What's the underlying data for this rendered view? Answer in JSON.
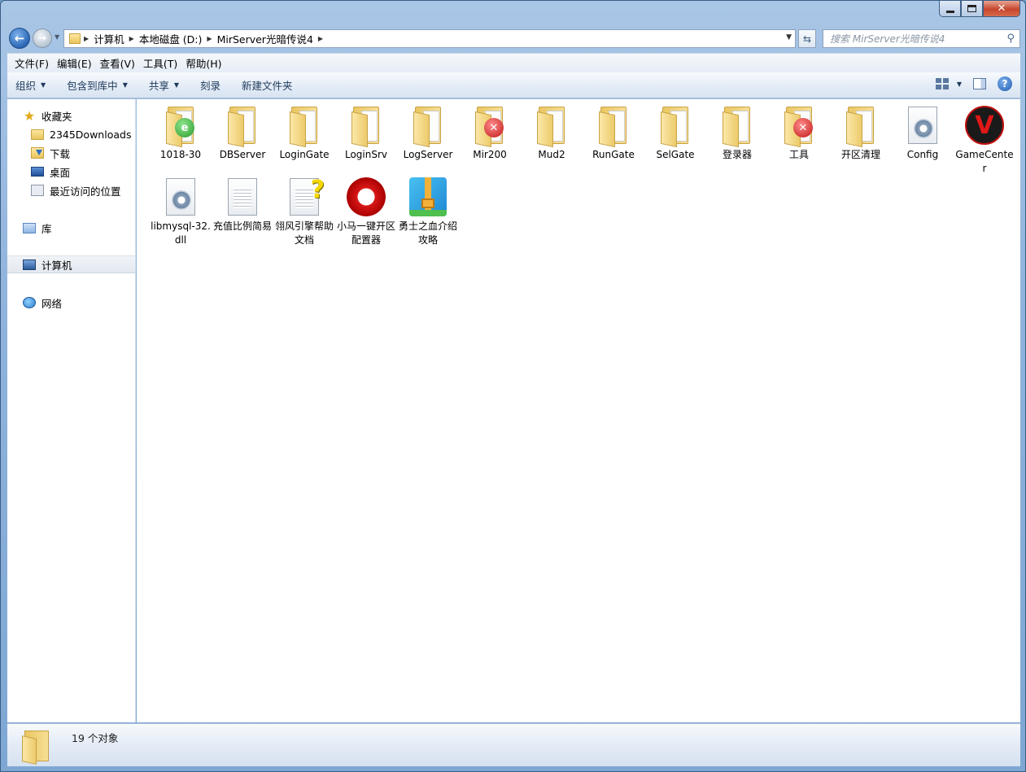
{
  "window": {
    "min_icon": "minimize-icon",
    "max_icon": "maximize-icon",
    "close_icon": "close-icon",
    "close_glyph": "✕"
  },
  "address": {
    "crumbs": [
      "计算机",
      "本地磁盘 (D:)",
      "MirServer光暗传说4"
    ]
  },
  "search": {
    "placeholder": "搜索 MirServer光暗传说4"
  },
  "menu": [
    "文件(F)",
    "编辑(E)",
    "查看(V)",
    "工具(T)",
    "帮助(H)"
  ],
  "toolbar": {
    "organize": "组织",
    "include_library": "包含到库中",
    "share": "共享",
    "burn": "刻录",
    "new_folder": "新建文件夹"
  },
  "nav": {
    "favorites": "收藏夹",
    "fav_items": [
      "2345Downloads",
      "下载",
      "桌面",
      "最近访问的位置"
    ],
    "libraries": "库",
    "computer": "计算机",
    "network": "网络"
  },
  "files": [
    {
      "name": "1018-30",
      "type": "folder",
      "overlay": "green",
      "icon": "folder-icon"
    },
    {
      "name": "DBServer",
      "type": "folder",
      "icon": "folder-icon"
    },
    {
      "name": "LoginGate",
      "type": "folder",
      "icon": "folder-icon"
    },
    {
      "name": "LoginSrv",
      "type": "folder",
      "icon": "folder-icon"
    },
    {
      "name": "LogServer",
      "type": "folder",
      "icon": "folder-icon"
    },
    {
      "name": "Mir200",
      "type": "folder",
      "overlay": "red",
      "icon": "folder-icon"
    },
    {
      "name": "Mud2",
      "type": "folder",
      "icon": "folder-icon"
    },
    {
      "name": "RunGate",
      "type": "folder",
      "icon": "folder-icon"
    },
    {
      "name": "SelGate",
      "type": "folder",
      "icon": "folder-icon"
    },
    {
      "name": "登录器",
      "type": "folder",
      "icon": "folder-icon"
    },
    {
      "name": "工具",
      "type": "folder",
      "overlay": "red",
      "icon": "folder-icon"
    },
    {
      "name": "开区清理",
      "type": "folder",
      "icon": "folder-icon"
    },
    {
      "name": "Config",
      "type": "config",
      "icon": "config-file-icon"
    },
    {
      "name": "GameCenter",
      "type": "app-v",
      "icon": "gamecenter-app-icon"
    },
    {
      "name": "libmysql-32.dll",
      "type": "dll",
      "icon": "dll-file-icon"
    },
    {
      "name": "充值比例简易",
      "type": "text",
      "icon": "text-file-icon"
    },
    {
      "name": "翎风引擎帮助文档",
      "type": "help",
      "icon": "help-file-icon"
    },
    {
      "name": "小马一键开区配置器",
      "type": "dragon",
      "icon": "dragon-app-icon"
    },
    {
      "name": "勇士之血介绍攻略",
      "type": "zip",
      "icon": "zip-archive-icon"
    }
  ],
  "status": {
    "count_text": "19 个对象"
  },
  "colors": {
    "accent": "#2a66b5",
    "folder": "#eccb6b"
  }
}
